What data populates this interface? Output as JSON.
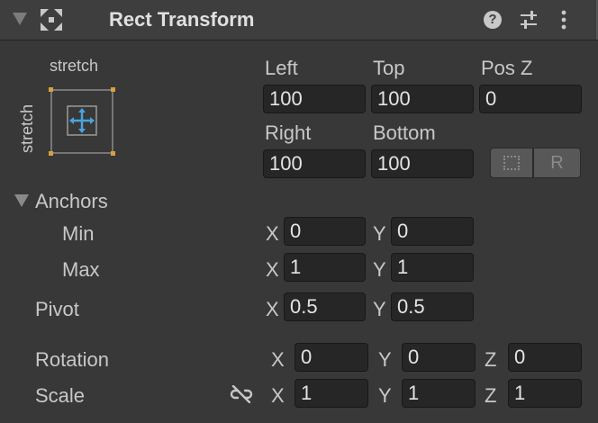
{
  "header": {
    "title": "Rect Transform"
  },
  "anchor_preset": {
    "horizontal": "stretch",
    "vertical": "stretch"
  },
  "position": {
    "left": {
      "label": "Left",
      "value": "100"
    },
    "top": {
      "label": "Top",
      "value": "100"
    },
    "pos_z": {
      "label": "Pos Z",
      "value": "0"
    },
    "right": {
      "label": "Right",
      "value": "100"
    },
    "bottom": {
      "label": "Bottom",
      "value": "100"
    }
  },
  "raw_edit_button": {
    "label": "R"
  },
  "anchors": {
    "label": "Anchors",
    "min": {
      "label": "Min",
      "x": "0",
      "y": "0"
    },
    "max": {
      "label": "Max",
      "x": "1",
      "y": "1"
    }
  },
  "pivot": {
    "label": "Pivot",
    "x": "0.5",
    "y": "0.5"
  },
  "rotation": {
    "label": "Rotation",
    "x": "0",
    "y": "0",
    "z": "0"
  },
  "scale": {
    "label": "Scale",
    "x": "1",
    "y": "1",
    "z": "1"
  },
  "axes": {
    "x": "X",
    "y": "Y",
    "z": "Z"
  },
  "colors": {
    "background": "#383838",
    "field": "#262626",
    "anchor_accent": "#4aa3df",
    "corner_handles": "#d7a13c"
  }
}
